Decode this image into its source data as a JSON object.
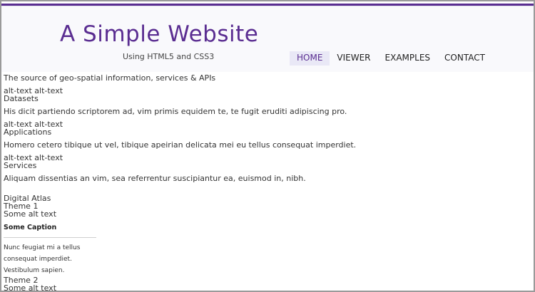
{
  "header": {
    "title": "A Simple Website",
    "subtitle": "Using HTML5 and CSS3"
  },
  "nav": {
    "items": [
      {
        "label": "HOME",
        "active": true
      },
      {
        "label": "VIEWER",
        "active": false
      },
      {
        "label": "EXAMPLES",
        "active": false
      },
      {
        "label": "CONTACT",
        "active": false
      }
    ]
  },
  "main": {
    "intro": "The source of geo-spatial information, services & APIs",
    "sections": [
      {
        "alt": "alt-text alt-text",
        "label": "Datasets",
        "text": "His dicit partiendo scriptorem ad, vim primis equidem te, te fugit eruditi adipiscing pro."
      },
      {
        "alt": "alt-text alt-text",
        "label": "Applications",
        "text": "Homero cetero tibique ut vel, tibique apeirian delicata mei eu tellus consequat imperdiet."
      },
      {
        "alt": "alt-text alt-text",
        "label": "Services",
        "text": "Aliquam dissentias an vim, sea referrentur suscipiantur ea, euismod in, nibh."
      }
    ],
    "atlas": {
      "title": "Digital Atlas",
      "theme1": "Theme 1",
      "theme1_alt": "Some alt text",
      "caption": "Some Caption",
      "caption_lines": [
        "Nunc feugiat mi a tellus",
        "consequat imperdiet.",
        "Vestibulum sapien."
      ],
      "theme2": "Theme 2",
      "theme2_alt": "Some alt text"
    }
  },
  "colors": {
    "brand": "#5a2d91",
    "nav_active_bg": "#e9e8f6"
  }
}
